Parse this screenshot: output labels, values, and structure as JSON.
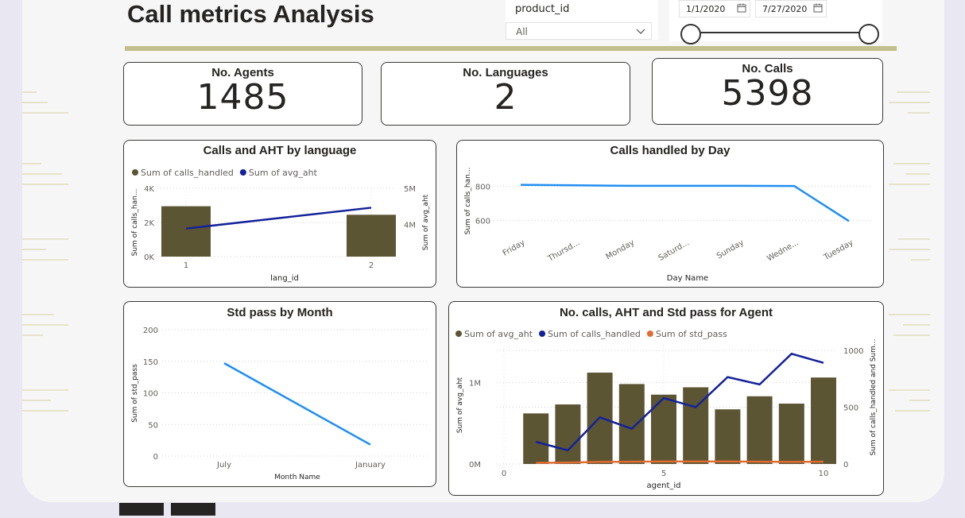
{
  "page": {
    "title": "Call metrics Analysis"
  },
  "slicer_product": {
    "label": "product_id",
    "value": "All"
  },
  "slicer_date": {
    "start": "1/1/2020",
    "end": "7/27/2020"
  },
  "kpis": [
    {
      "label": "No. Agents",
      "value": "1485"
    },
    {
      "label": "No. Languages",
      "value": "2"
    },
    {
      "label": "No. Calls",
      "value": "5398"
    }
  ],
  "colors": {
    "olive": "#5c5533",
    "navy": "#14229a",
    "blue": "#1f8ef2",
    "orange": "#e06d33",
    "accent_bar": "#c2bf8f"
  },
  "chart_data": [
    {
      "id": "lang",
      "type": "bar",
      "title": "Calls and AHT by language",
      "xlabel": "lang_id",
      "ylabel": "Sum of calls_han...",
      "y2label": "Sum of avg_aht",
      "categories": [
        "1",
        "2"
      ],
      "series": [
        {
          "name": "Sum of calls_handled",
          "type": "bar",
          "values": [
            2950,
            2450
          ]
        },
        {
          "name": "Sum of avg_aht",
          "type": "line",
          "axis": "secondary",
          "values": [
            3880000,
            4460000
          ]
        }
      ],
      "ylim": [
        0,
        4000
      ],
      "yticks": [
        "0K",
        "2K",
        "4K"
      ],
      "y2lim": [
        3100000,
        5000000
      ],
      "y2ticks": [
        "4M",
        "5M"
      ],
      "legend": "top-left"
    },
    {
      "id": "day",
      "type": "line",
      "title": "Calls handled by Day",
      "xlabel": "Day Name",
      "ylabel": "Sum of calls_han...",
      "categories": [
        "Friday",
        "Thursd...",
        "Monday",
        "Saturd...",
        "Sunday",
        "Wedne...",
        "Tuesday"
      ],
      "series": [
        {
          "name": "Sum of calls_handled",
          "values": [
            808,
            805,
            802,
            802,
            802,
            801,
            597
          ]
        }
      ],
      "ylim": [
        520,
        880
      ],
      "yticks": [
        600,
        800
      ]
    },
    {
      "id": "month",
      "type": "line",
      "title": "Std pass by Month",
      "xlabel": "Month Name",
      "ylabel": "Sum of std_pass",
      "categories": [
        "July",
        "January"
      ],
      "series": [
        {
          "name": "Sum of std_pass",
          "values": [
            147,
            18
          ]
        }
      ],
      "ylim": [
        0,
        200
      ],
      "yticks": [
        0,
        50,
        100,
        150,
        200
      ]
    },
    {
      "id": "agent",
      "type": "bar",
      "title": "No. calls, AHT and Std pass for Agent",
      "xlabel": "agent_id",
      "ylabel": "Sum of avg_aht",
      "y2label": "Sum of calls_handled and Sum...",
      "x": [
        1,
        2,
        3,
        4,
        5,
        6,
        7,
        8,
        9,
        10
      ],
      "series": [
        {
          "name": "Sum of avg_aht",
          "type": "bar",
          "values": [
            620000,
            730000,
            1120000,
            980000,
            850000,
            940000,
            670000,
            830000,
            740000,
            1060000
          ]
        },
        {
          "name": "Sum of calls_handled",
          "type": "line",
          "axis": "secondary",
          "values": [
            195,
            120,
            410,
            310,
            580,
            500,
            765,
            700,
            970,
            890
          ]
        },
        {
          "name": "Sum of std_pass",
          "type": "line",
          "axis": "secondary",
          "values": [
            10,
            12,
            18,
            20,
            22,
            22,
            22,
            20,
            18,
            20
          ]
        }
      ],
      "xlim": [
        0,
        10.7
      ],
      "xticks": [
        0,
        5,
        10
      ],
      "ylim": [
        0,
        1500000
      ],
      "yticks": [
        "0M",
        "1M"
      ],
      "y2lim": [
        0,
        1000
      ],
      "y2ticks": [
        0,
        500,
        1000
      ],
      "legend": "top-left"
    }
  ]
}
